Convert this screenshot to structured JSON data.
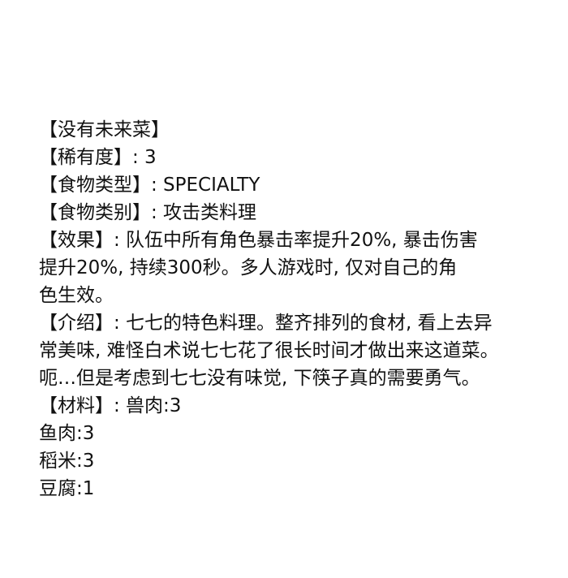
{
  "lines": [
    "【没有未来菜】",
    "【稀有度】: 3",
    "【食物类型】: SPECIALTY",
    "【食物类别】: 攻击类料理",
    "【效果】: 队伍中所有角色暴击率提升20%, 暴击伤害",
    "提升20%, 持续300秒。多人游戏时, 仅对自己的角",
    "色生效。",
    "【介绍】: 七七的特色料理。整齐排列的食材, 看上去异",
    "常美味, 难怪白术说七七花了很长时间才做出来这道菜。",
    "呃…但是考虑到七七没有味觉, 下筷子真的需要勇气。",
    "【材料】: 兽肉:3",
    "鱼肉:3",
    "稻米:3",
    "豆腐:1"
  ]
}
